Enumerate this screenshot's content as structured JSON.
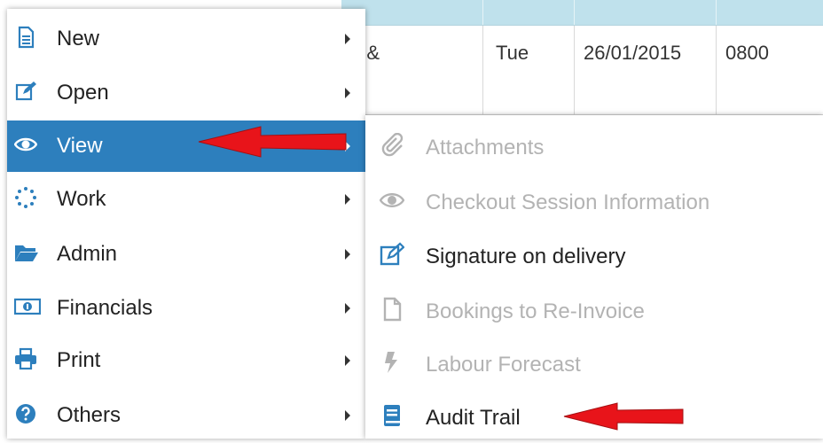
{
  "table": {
    "row": {
      "col1": "e &",
      "col2": "Tue",
      "col3": "26/01/2015",
      "col4": "0800"
    }
  },
  "menu": {
    "items": [
      {
        "label": "New",
        "icon": "document-icon"
      },
      {
        "label": "Open",
        "icon": "edit-icon"
      },
      {
        "label": "View",
        "icon": "eye-icon"
      },
      {
        "label": "Work",
        "icon": "spinner-icon"
      },
      {
        "label": "Admin",
        "icon": "folder-open-icon"
      },
      {
        "label": "Financials",
        "icon": "money-icon"
      },
      {
        "label": "Print",
        "icon": "printer-icon"
      },
      {
        "label": "Others",
        "icon": "question-circle-icon"
      }
    ]
  },
  "submenu": {
    "items": [
      {
        "label": "Attachments",
        "icon": "paperclip-icon",
        "enabled": false
      },
      {
        "label": "Checkout Session Information",
        "icon": "eye-icon",
        "enabled": false
      },
      {
        "label": "Signature on delivery",
        "icon": "edit-icon",
        "enabled": true
      },
      {
        "label": "Bookings to Re-Invoice",
        "icon": "file-icon",
        "enabled": false
      },
      {
        "label": "Labour Forecast",
        "icon": "bolt-icon",
        "enabled": false
      },
      {
        "label": "Audit Trail",
        "icon": "book-icon",
        "enabled": true
      }
    ]
  },
  "colors": {
    "accent": "#2d7fbd",
    "disabled_text": "#b3b3b3",
    "annotation_arrow": "#e8141a",
    "table_header": "#bfe1ec"
  }
}
